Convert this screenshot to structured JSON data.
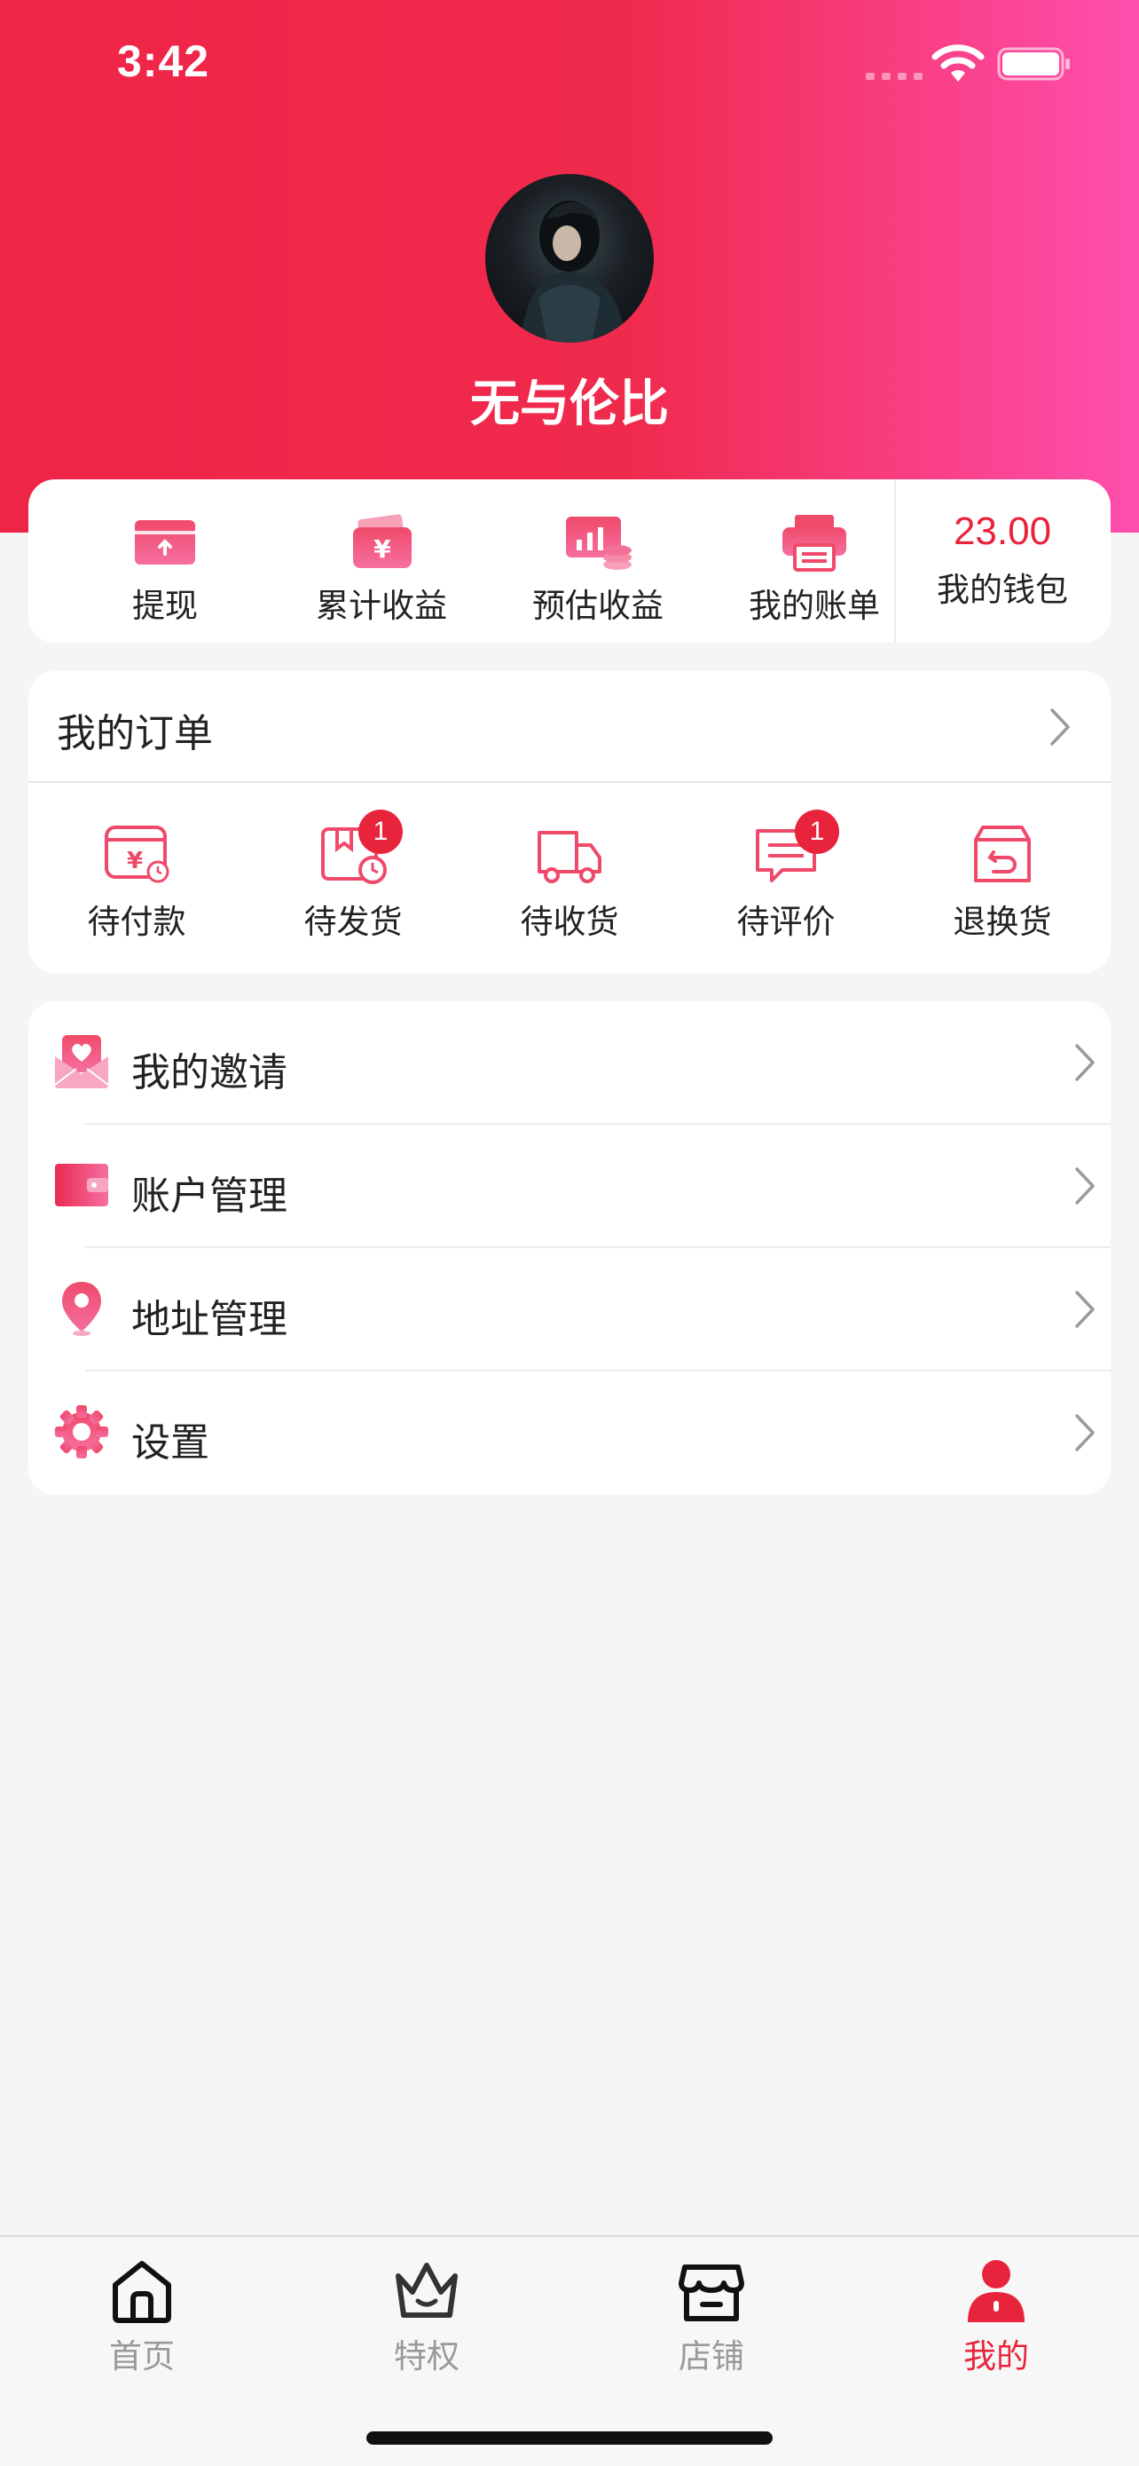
{
  "status": {
    "time": "3:42"
  },
  "profile": {
    "username": "无与伦比"
  },
  "earnings": {
    "items": [
      {
        "label": "提现",
        "icon": "withdraw-card-icon"
      },
      {
        "label": "累计收益",
        "icon": "yuan-wallet-icon"
      },
      {
        "label": "预估收益",
        "icon": "chart-coins-icon"
      },
      {
        "label": "我的账单",
        "icon": "printer-bill-icon"
      }
    ],
    "wallet": {
      "amount": "23.00",
      "label": "我的钱包"
    }
  },
  "orders": {
    "title": "我的订单",
    "items": [
      {
        "label": "待付款",
        "icon": "payment-pending-icon",
        "badge": ""
      },
      {
        "label": "待发货",
        "icon": "shipping-pending-icon",
        "badge": "1"
      },
      {
        "label": "待收货",
        "icon": "delivery-truck-icon",
        "badge": ""
      },
      {
        "label": "待评价",
        "icon": "review-message-icon",
        "badge": "1"
      },
      {
        "label": "退换货",
        "icon": "return-box-icon",
        "badge": ""
      }
    ]
  },
  "menu": {
    "items": [
      {
        "label": "我的邀请",
        "icon": "heart-envelope-icon"
      },
      {
        "label": "账户管理",
        "icon": "wallet-card-icon"
      },
      {
        "label": "地址管理",
        "icon": "location-pin-icon"
      },
      {
        "label": "设置",
        "icon": "gear-icon"
      }
    ]
  },
  "tabbar": {
    "items": [
      {
        "label": "首页",
        "icon": "home-icon",
        "active": false
      },
      {
        "label": "特权",
        "icon": "crown-icon",
        "active": false
      },
      {
        "label": "店铺",
        "icon": "store-icon",
        "active": false
      },
      {
        "label": "我的",
        "icon": "person-icon",
        "active": true
      }
    ]
  },
  "colors": {
    "accent": "#e8243c",
    "gradient_start": "#ef2547",
    "gradient_end": "#ff4fae",
    "background": "#f5f5f5"
  }
}
